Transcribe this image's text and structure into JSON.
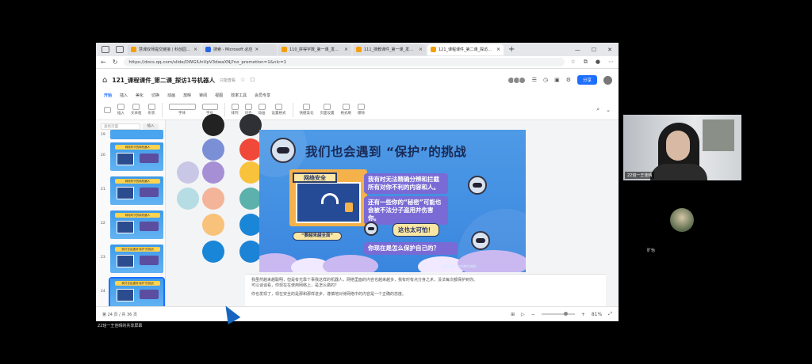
{
  "browser": {
    "tabs": [
      {
        "label": "慧课双师提交链接丨科创园图..."
      },
      {
        "label": "搜索 - Microsoft 必应"
      },
      {
        "label": "110_拼得字数_第一课_发现云朗..."
      },
      {
        "label": "111_搜教课件_第一课_发现云朗..."
      },
      {
        "label": "121_课程课件_第二课_探访1号机..."
      }
    ],
    "url": "https://docs.qq.com/slide/DWGlUnVpV3dwaXNj?no_promotion=1&nlc=1",
    "window_controls": [
      "—",
      "☐",
      "✕"
    ]
  },
  "doc": {
    "title": "121_课程课件_第二课_探访1号机器人",
    "saved": "只能查看",
    "share_label": "分享",
    "menu_tabs": [
      "开始",
      "插入",
      "美化",
      "切换",
      "动画",
      "放映",
      "审阅",
      "视图",
      "效率工具",
      "会员专享"
    ],
    "ribbon": [
      "插入",
      "文本框",
      "形状",
      "字体",
      "字号",
      "排列",
      "对齐",
      "动画",
      "设置格式",
      "快捷美化",
      "页面设置",
      "格式刷",
      "擦除"
    ]
  },
  "thumbs": {
    "search_placeholder": "查找页面",
    "search_button": "插入",
    "slides": [
      {
        "num": "19",
        "title": "..."
      },
      {
        "num": "20",
        "title": "网络时代的新机器人"
      },
      {
        "num": "21",
        "title": "网络时代的新机器人"
      },
      {
        "num": "22",
        "title": "网络时代的新机器人"
      },
      {
        "num": "23",
        "title": "我们也会遇到'保护'的挑战"
      },
      {
        "num": "24",
        "title": "我们也会遇到'保护'的挑战"
      }
    ]
  },
  "swatch_colors": [
    "#222222",
    "#2e3036",
    "#7b8fd6",
    "#f0493a",
    "#c8c8e6",
    "#a78fd6",
    "#f9c23c",
    "#b6dde3",
    "#f4b49a",
    "#5cb1ac",
    "#f8c27a",
    "#1a86d8",
    "#1a86d8",
    "#1d83d6"
  ],
  "slide": {
    "title": "我们也会遇到 “保护”的挑战",
    "net_label": "网络安全",
    "badge": "“要越来越全面”",
    "bubble1": "我有时无法精确分辨和拦截所有对你不利的内容和人。",
    "bubble2": "还有一些你的“秘密”可能也会被不法分子盗用并伤害你。",
    "bubble3": "这也太可怕！",
    "bubble4": "你现在是怎么保护自己的？",
    "footer": "版权所有 · 仅供教学使用"
  },
  "notes": {
    "line1": "我虽然越来越聪明，但是有光靠个事我这样的机器人，网络里面的内容也越来越多，我有时有点分身之术，没法每次都保护到你。",
    "line2": "可以谈谈看，你现在在使用网络上，是怎么做的？",
    "line3": "你也发现了，现在安全的是那和那样进步，谨慎地对待网络中的内容是一个正确的态度。"
  },
  "status": {
    "page_info": "第 24 页 / 共 36 页",
    "zoom": "81%"
  },
  "meeting": {
    "presenter_label": "22班一王佳晴",
    "participant_name": "旷怡",
    "share_status": "22班一王佳晴的共享屏幕"
  }
}
